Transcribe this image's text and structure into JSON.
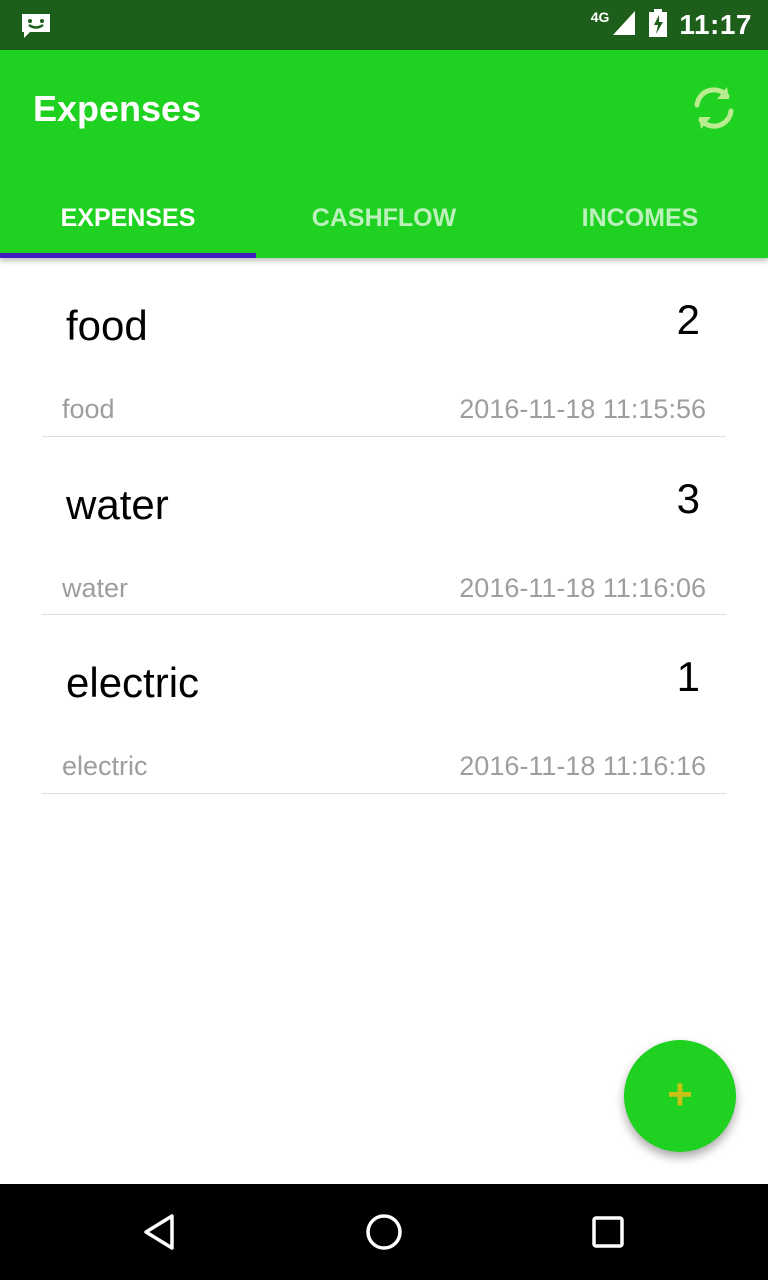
{
  "status_bar": {
    "notification_icon": "message-icon",
    "network": "4G",
    "time": "11:17"
  },
  "app_bar": {
    "title": "Expenses",
    "sync_icon": "sync-icon",
    "accent_color": "#1fd120",
    "indicator_color": "#3d1bbf"
  },
  "tabs": [
    {
      "label": "EXPENSES",
      "active": true
    },
    {
      "label": "CASHFLOW",
      "active": false
    },
    {
      "label": "INCOMES",
      "active": false
    }
  ],
  "expenses": [
    {
      "title": "food",
      "amount": "2",
      "category": "food",
      "date": "2016-11-18 11:15:56"
    },
    {
      "title": "water",
      "amount": "3",
      "category": "water",
      "date": "2016-11-18 11:16:06"
    },
    {
      "title": "electric",
      "amount": "1",
      "category": "electric",
      "date": "2016-11-18 11:16:16"
    }
  ],
  "fab": {
    "label": "+",
    "icon": "add-icon"
  },
  "nav_bar": {
    "back_icon": "back-icon",
    "home_icon": "home-icon",
    "recents_icon": "recents-icon"
  }
}
